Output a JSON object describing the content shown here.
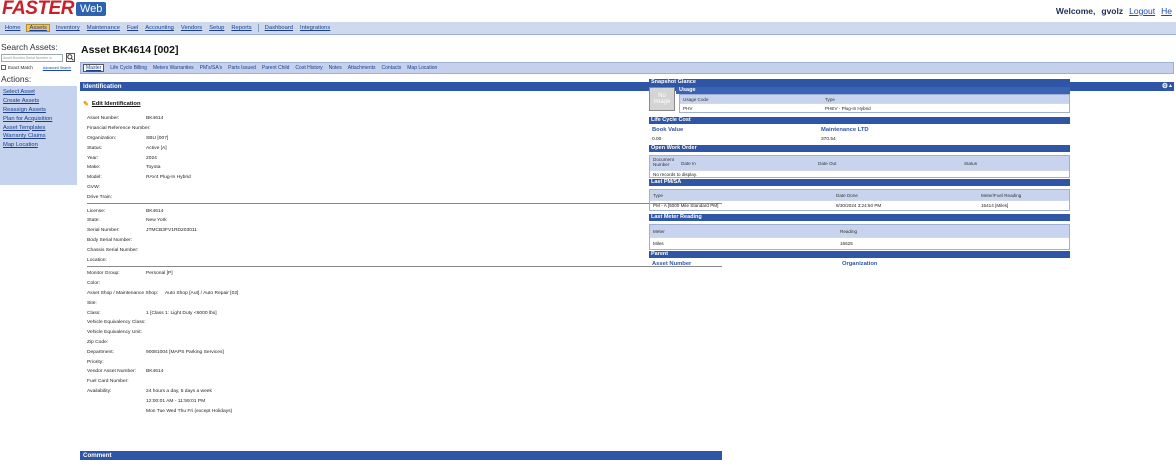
{
  "header": {
    "logo_main": "FASTER",
    "logo_badge": "Web",
    "welcome": "Welcome,",
    "username": "gvolz",
    "logout": "Logout",
    "help": "He"
  },
  "nav": {
    "items": [
      "Home",
      "Assets",
      "Inventory",
      "Maintenance",
      "Fuel",
      "Accounting",
      "Vendors",
      "Setup",
      "Reports"
    ],
    "items2": [
      "Dashboard",
      "Integrations"
    ],
    "active_index": 1
  },
  "sidebar": {
    "search_title": "Search Assets:",
    "search_placeholder": "Asset Number,Serial Number or",
    "exact_match": "Exact Match",
    "advanced_search": "Advanced Search",
    "actions_title": "Actions:",
    "actions": [
      "Select Asset",
      "Create Assets",
      "Reassign Assets",
      "Plan for Acquisition",
      "Asset Templates",
      "Warranty Claims",
      "Map Location"
    ]
  },
  "main": {
    "asset_title": "Asset BK4614 [002]",
    "tabs": [
      "Master",
      "Life Cycle Billing",
      "Meters Warranties",
      "PM's/SA's",
      "Parts Issued",
      "Parent Child",
      "Cost History",
      "Notes",
      "Attachments",
      "Contacts",
      "Map Location"
    ],
    "active_tab": 0,
    "section_title": "Identification",
    "edit_label": "Edit Identification",
    "group1": [
      {
        "k": "Asset Number:",
        "v": "BK4614"
      },
      {
        "k": "Financial Reference Number:",
        "v": ""
      },
      {
        "k": "Organization:",
        "v": "SBU [007]"
      },
      {
        "k": "Status:",
        "v": "Active [A]"
      },
      {
        "k": "Year:",
        "v": "2024"
      },
      {
        "k": "Make:",
        "v": "Toyota"
      },
      {
        "k": "Model:",
        "v": "RAV4 Plug-In Hybrid"
      },
      {
        "k": "GVW:",
        "v": ""
      },
      {
        "k": "Drive Train:",
        "v": ""
      }
    ],
    "group2": [
      {
        "k": "License:",
        "v": "BK4614"
      },
      {
        "k": "State:",
        "v": "New York"
      },
      {
        "k": "Serial Number:",
        "v": "JTMCB3FV1RD203011"
      },
      {
        "k": "Body Serial Number:",
        "v": ""
      },
      {
        "k": "Chassis Serial Number:",
        "v": ""
      },
      {
        "k": "Location:",
        "v": ""
      }
    ],
    "group3": [
      {
        "k": "Monitor Group:",
        "v": "Personal [P]"
      },
      {
        "k": "Color:",
        "v": ""
      },
      {
        "k": "Asset Shop / Maintenance Shop:",
        "v": "Auto Shop [Aut] / Auto Repair [02]"
      },
      {
        "k": "Site:",
        "v": ""
      },
      {
        "k": "Class:",
        "v": "1 [Class 1: Light Duty <6000 lbs]"
      },
      {
        "k": "Vehicle Equivalency Class:",
        "v": ""
      },
      {
        "k": "Vehicle Equivalency Unit:",
        "v": ""
      },
      {
        "k": "Zip Code:",
        "v": ""
      },
      {
        "k": "Department:",
        "v": "90081004 [MAPS Parking Services]"
      },
      {
        "k": "Priority:",
        "v": ""
      },
      {
        "k": "Vendor Asset Number:",
        "v": "BK4614"
      },
      {
        "k": "Fuel Card Number:",
        "v": ""
      },
      {
        "k": "Availability:",
        "v": "24 hours a day, 5 days a week"
      },
      {
        "k": "",
        "v": "12:00:01 AM - 11:59:01 PM"
      },
      {
        "k": "",
        "v": "Mon Tue Wed Thu Fri (except Holidays)"
      }
    ],
    "comment_title": "Comment"
  },
  "snapshot": {
    "title": "Snapshot Glance",
    "no_image": "No Image",
    "usage_title": "Usage",
    "usage_headers": [
      "Usage Code",
      "Type"
    ],
    "usage_rows": [
      [
        "PHV",
        "PHEV - Plug-In Hybrid"
      ]
    ],
    "lcc_title": "Life Cycle Cost",
    "book_value_label": "Book Value",
    "maint_ltd_label": "Maintenance LTD",
    "book_value": "0.00",
    "maint_ltd": "370.54",
    "owo_title": "Open Work Order",
    "owo_headers": [
      "Document Number",
      "Date In",
      "Date Out",
      "Status"
    ],
    "owo_empty": "No records to display.",
    "pm_title": "Last PM/SA",
    "pm_headers": [
      "Type",
      "Date Done",
      "Meter/Fuel Reading"
    ],
    "pm_rows": [
      [
        "PM - A [5000 Mile Standard PM]",
        "8/30/2024 3:24:50 PM",
        "15414 [Miles]"
      ]
    ],
    "meter_title": "Last Meter Reading",
    "meter_headers": [
      "Meter",
      "Reading"
    ],
    "meter_rows": [
      [
        "Miles",
        "16625"
      ]
    ],
    "parent_title": "Parent",
    "parent_asset_label": "Asset Number",
    "parent_org_label": "Organization"
  },
  "colors": {
    "brand_red": "#c8202a",
    "header_blue": "#2f56a6",
    "nav_bg": "#cfd9ee",
    "active_tab": "#f4c35c"
  }
}
